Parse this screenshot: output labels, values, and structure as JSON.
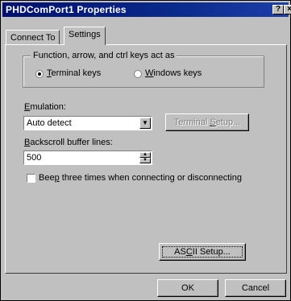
{
  "window": {
    "title": "PHDComPort1 Properties",
    "help_glyph": "?",
    "close_glyph": "×"
  },
  "tabs": [
    {
      "label": "Connect To",
      "active": false
    },
    {
      "label": "Settings",
      "active": true
    }
  ],
  "keys_group": {
    "legend": "Function, arrow, and ctrl keys act as",
    "options": [
      {
        "label_pre": "",
        "mnemonic": "T",
        "label_post": "erminal keys",
        "selected": true
      },
      {
        "label_pre": "",
        "mnemonic": "W",
        "label_post": "indows keys",
        "selected": false
      }
    ]
  },
  "emulation": {
    "label_pre": "",
    "mnemonic": "E",
    "label_post": "mulation:",
    "value": "Auto detect",
    "setup_button": {
      "label_pre": "Terminal ",
      "mnemonic": "S",
      "label_post": "etup...",
      "enabled": false
    }
  },
  "backscroll": {
    "label_pre": "",
    "mnemonic": "B",
    "label_post": "ackscroll buffer lines:",
    "value": "500"
  },
  "beep": {
    "label_pre": "Bee",
    "mnemonic": "p",
    "label_post": " three times when connecting or disconnecting",
    "checked": false
  },
  "ascii_button": {
    "label_pre": "AS",
    "mnemonic": "C",
    "label_post": "II Setup..."
  },
  "footer": {
    "ok_label": "OK",
    "cancel_label": "Cancel"
  }
}
